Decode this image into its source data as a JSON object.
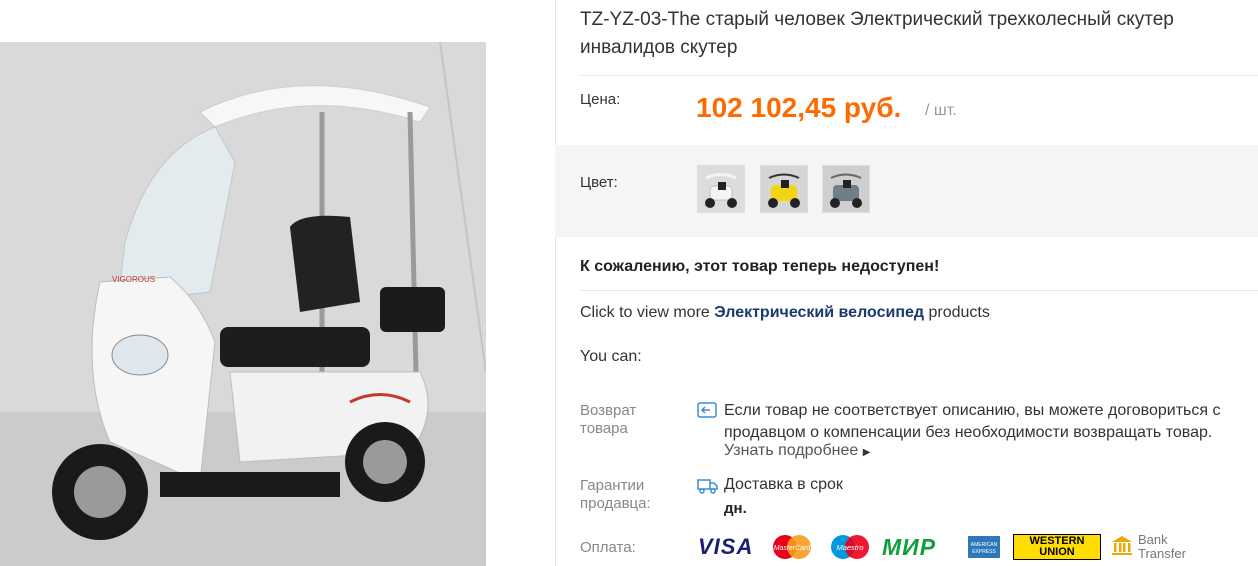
{
  "product": {
    "title": "TZ-YZ-03-The старый человек Электрический трехколесный скутер инвалидов скутер",
    "price_label": "Цена:",
    "price": "102 102,45 руб.",
    "unit": "/ шт.",
    "color_label": "Цвет:",
    "colors": [
      "white",
      "yellow",
      "gray"
    ],
    "unavailable": "К сожалению, этот товар теперь недоступен!",
    "more_prefix": "Click to view more ",
    "more_link": "Электрический велосипед",
    "more_suffix": " products",
    "you_can": "You can:"
  },
  "returns": {
    "label": "Возврат товара",
    "text": "Если товар не соответствует описанию, вы можете договориться с продавцом о компенсации без необходимости возвращать товар.",
    "learn_more": "Узнать подробнее"
  },
  "guarantee": {
    "label": "Гарантии продавца:",
    "delivery": "Доставка в срок",
    "days": "дн."
  },
  "payment": {
    "label": "Оплата:",
    "methods": [
      "VISA",
      "MasterCard",
      "Maestro",
      "МИР",
      "American Express",
      "WESTERN UNION",
      "Bank Transfer"
    ],
    "bank_line1": "Bank",
    "bank_line2": "Transfer",
    "wu_line1": "WESTERN",
    "wu_line2": "UNION"
  },
  "colors": {
    "price": "#ff6a00",
    "link": "#1a3a6e",
    "scooter_white": "#f4f4f4",
    "scooter_yellow": "#f2d616"
  }
}
